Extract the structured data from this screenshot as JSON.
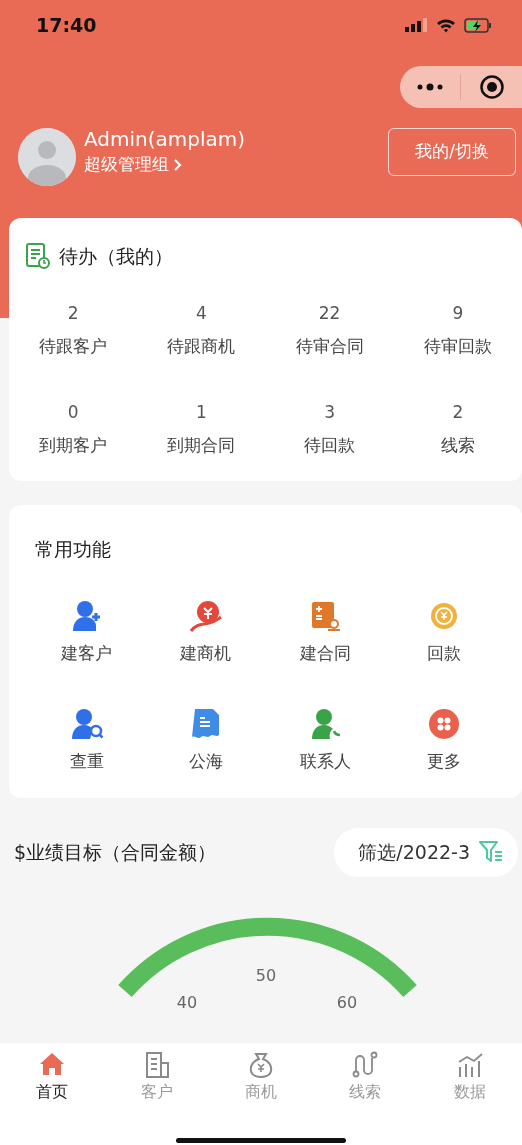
{
  "status_bar": {
    "time": "17:40"
  },
  "profile": {
    "name": "Admin(amplam)",
    "role": "超级管理组",
    "switch_button": "我的/切换"
  },
  "todo": {
    "title": "待办（我的）",
    "items": [
      {
        "count": "2",
        "label": "待跟客户"
      },
      {
        "count": "4",
        "label": "待跟商机"
      },
      {
        "count": "22",
        "label": "待审合同"
      },
      {
        "count": "9",
        "label": "待审回款"
      },
      {
        "count": "0",
        "label": "到期客户"
      },
      {
        "count": "1",
        "label": "到期合同"
      },
      {
        "count": "3",
        "label": "待回款"
      },
      {
        "count": "2",
        "label": "线索"
      }
    ]
  },
  "functions": {
    "title": "常用功能",
    "items": [
      {
        "label": "建客户",
        "kind": "user-add",
        "color": "#2f6fe8"
      },
      {
        "label": "建商机",
        "kind": "money-hand",
        "color": "#e5483b"
      },
      {
        "label": "建合同",
        "kind": "contract",
        "color": "#e0782a"
      },
      {
        "label": "回款",
        "kind": "coin",
        "color": "#f0b23c"
      },
      {
        "label": "查重",
        "kind": "user-search",
        "color": "#2f6fe8"
      },
      {
        "label": "公海",
        "kind": "document",
        "color": "#3f8be8"
      },
      {
        "label": "联系人",
        "kind": "user-phone",
        "color": "#3aa34a"
      },
      {
        "label": "更多",
        "kind": "more",
        "color": "#e9604c"
      }
    ]
  },
  "goal": {
    "title": "$业绩目标（合同金额）",
    "filter": "筛选/2022-3",
    "gauge_labels": [
      "40",
      "50",
      "60"
    ]
  },
  "tab_bar": [
    {
      "label": "首页",
      "kind": "home",
      "selected": true
    },
    {
      "label": "客户",
      "kind": "building",
      "selected": false
    },
    {
      "label": "商机",
      "kind": "moneybag",
      "selected": false
    },
    {
      "label": "线索",
      "kind": "path",
      "selected": false
    },
    {
      "label": "数据",
      "kind": "chart",
      "selected": false
    }
  ]
}
